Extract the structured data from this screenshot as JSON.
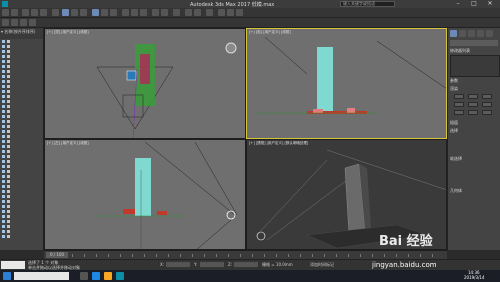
{
  "title_bar": {
    "title": "Autodesk 3ds Max 2017    低模.max",
    "search_placeholder": "键入关键字或短语"
  },
  "viewports": {
    "top": "[+] [顶] [用户定义] [线框]",
    "front": "[+] [前] [用户定义] [线框]",
    "left": "[+] [左] [用户定义] [线框]",
    "perspective": "[+] [透视] [用户定义] [默认明暗处理]"
  },
  "command_panel": {
    "modifier_list": "修改器列表",
    "rollouts": [
      "参数",
      "渲染",
      "插值",
      "选择",
      "软选择",
      "几何体"
    ]
  },
  "timeline": {
    "frame": "0 / 100"
  },
  "status": {
    "selection": "选择了 1 个 对象",
    "hint": "单击并拖动以选择并移动对象",
    "x_label": "X:",
    "y_label": "Y:",
    "z_label": "Z:",
    "grid": "栅格 = 10.0mm",
    "add_key": "添加时间标记"
  },
  "taskbar": {
    "time": "14:36",
    "date": "2019/3/14"
  },
  "watermark": {
    "brand": "Bai 经验",
    "url": "jingyan.baidu.com"
  }
}
